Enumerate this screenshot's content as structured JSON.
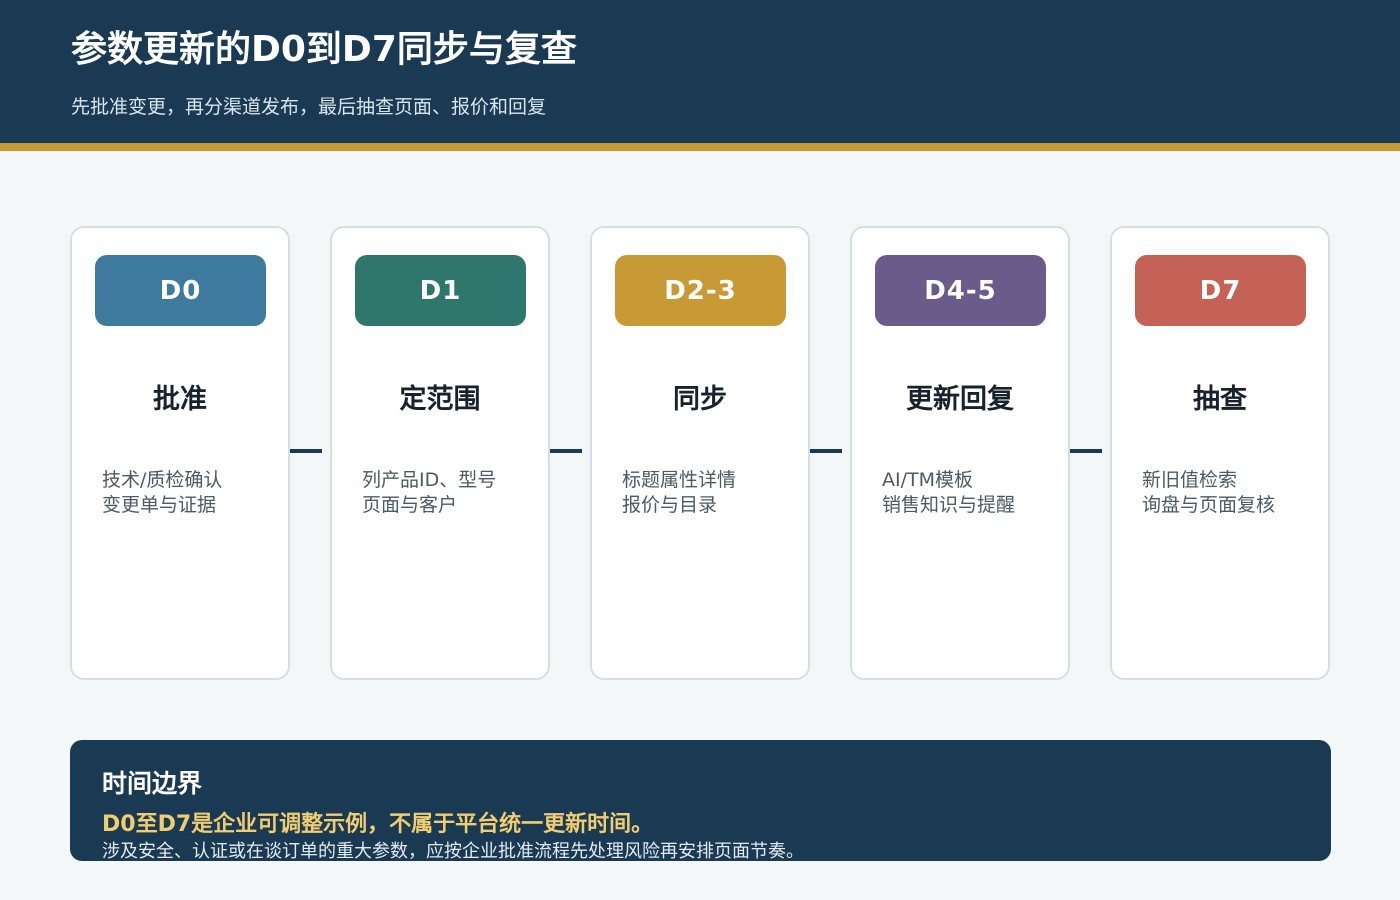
{
  "header": {
    "title": "参数更新的D0到D7同步与复查",
    "subtitle": "先批准变更，再分渠道发布，最后抽查页面、报价和回复"
  },
  "stages": [
    {
      "badge": "D0",
      "title": "批准",
      "lines": [
        "技术/质检确认",
        "变更单与证据"
      ],
      "color": "#3d7a9e"
    },
    {
      "badge": "D1",
      "title": "定范围",
      "lines": [
        "列产品ID、型号",
        "页面与客户"
      ],
      "color": "#2f766c"
    },
    {
      "badge": "D2-3",
      "title": "同步",
      "lines": [
        "标题属性详情",
        "报价与目录"
      ],
      "color": "#c89a35"
    },
    {
      "badge": "D4-5",
      "title": "更新回复",
      "lines": [
        "AI/TM模板",
        "销售知识与提醒"
      ],
      "color": "#6b5b8a"
    },
    {
      "badge": "D7",
      "title": "抽查",
      "lines": [
        "新旧值检索",
        "询盘与页面复核"
      ],
      "color": "#c46355"
    }
  ],
  "note": {
    "title": "时间边界",
    "highlight": "D0至D7是企业可调整示例，不属于平台统一更新时间。",
    "body": "涉及安全、认证或在谈订单的重大参数，应按企业批准流程先处理风险再安排页面节奏。"
  }
}
